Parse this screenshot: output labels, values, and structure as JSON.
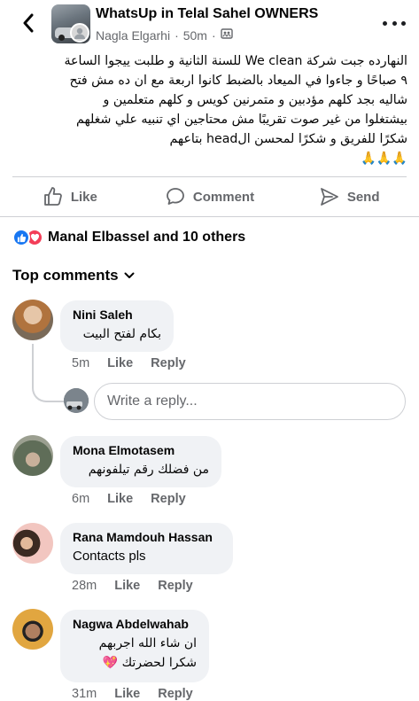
{
  "header": {
    "group_name": "WhatsUp in Telal Sahel OWNERS",
    "author": "Nagla Elgarhi",
    "separator": "·",
    "time": "50m",
    "audience_sep": "·"
  },
  "post": {
    "line1": "النهارده جبت شركة We clean  للسنة الثانية و طلبت ييجوا الساعة",
    "line2": "٩ صباحًا و جاءوا في الميعاد بالضبط كانوا اربعة مع ان ده مش فتح",
    "line3": "شاليه  بجد كلهم  مؤدبين و متمرنين كويس و كلهم متعلمين و",
    "line4": "بيشتغلوا من غير صوت تقريبًا مش محتاجين اي تنبيه علي شغلهم",
    "line5": "شكرًا للفريق و شكرًا لمحسن الhead بتاعهم",
    "emoji": "🙏🙏🙏"
  },
  "actions": {
    "like": "Like",
    "comment": "Comment",
    "send": "Send"
  },
  "reactions": {
    "summary": "Manal Elbassel and 10 others"
  },
  "comments_header": "Top comments",
  "comments": [
    {
      "name": "Nini Saleh",
      "text": "بكام لفتح البيت",
      "time": "5m",
      "like": "Like",
      "reply": "Reply"
    },
    {
      "name": "Mona Elmotasem",
      "text": "من فضلك رقم تيلفونهم",
      "time": "6m",
      "like": "Like",
      "reply": "Reply"
    },
    {
      "name": "Rana Mamdouh Hassan",
      "text": "Contacts pls",
      "time": "28m",
      "like": "Like",
      "reply": "Reply"
    },
    {
      "name": "Nagwa Abdelwahab",
      "text_line1": "ان شاء الله اجربهم",
      "text_line2": "شكرا لحضرتك 💖",
      "time": "31m",
      "like": "Like",
      "reply": "Reply"
    }
  ],
  "reply_box": {
    "placeholder": "Write a reply..."
  },
  "colors": {
    "accent": "#1877f2",
    "love": "#f33e58",
    "secondary_text": "#65676b",
    "bubble": "#f0f2f5"
  }
}
